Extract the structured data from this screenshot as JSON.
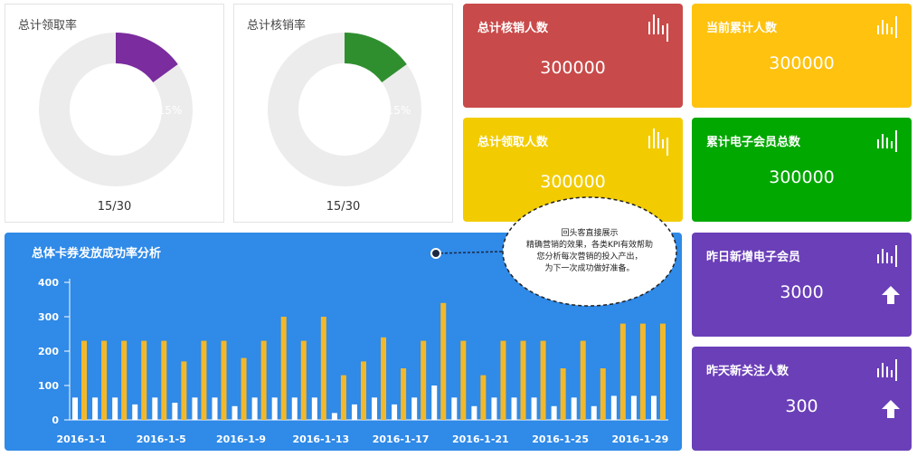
{
  "donuts": [
    {
      "title": "总计领取率",
      "percent_label": "15%",
      "fraction": 0.15,
      "caption": "15/30",
      "color": "#7b2c9e"
    },
    {
      "title": "总计核销率",
      "percent_label": "15%",
      "fraction": 0.15,
      "caption": "15/30",
      "color": "#2f8f2f"
    }
  ],
  "cards": {
    "redeemed": {
      "title": "总计核销人数",
      "value": "300000",
      "color": "#c94a4a"
    },
    "received": {
      "title": "总计领取人数",
      "value": "300000",
      "color": "#f2cc00"
    },
    "cumulative": {
      "title": "当前累计人数",
      "value": "300000",
      "color": "#ffc20e"
    },
    "members": {
      "title": "累计电子会员总数",
      "value": "300000",
      "color": "#00a800"
    },
    "new_members": {
      "title": "昨日新增电子会员",
      "value": "3000",
      "color": "#6a3fb8"
    },
    "new_follow": {
      "title": "昨天新关注人数",
      "value": "300",
      "color": "#6a3fb8"
    }
  },
  "chart": {
    "title": "总体卡券发放成功率分析"
  },
  "bubble": {
    "line1": "回头客直接展示",
    "line2": "精确营销的效果，各类KPI有效帮助",
    "line3": "您分析每次营销的投入产出，",
    "line4": "为下一次成功做好准备。"
  },
  "chart_data": {
    "type": "bar",
    "title": "总体卡券发放成功率分析",
    "ylim": [
      0,
      400
    ],
    "yticks": [
      "0",
      "100",
      "200",
      "300",
      "400"
    ],
    "xtick_labels": [
      "2016-1-1",
      "2016-1-5",
      "2016-1-9",
      "2016-1-13",
      "2016-1-17",
      "2016-1-21",
      "2016-1-25",
      "2016-1-29"
    ],
    "categories": [
      "2016-1-1",
      "2016-1-2",
      "2016-1-3",
      "2016-1-4",
      "2016-1-5",
      "2016-1-6",
      "2016-1-7",
      "2016-1-8",
      "2016-1-9",
      "2016-1-10",
      "2016-1-11",
      "2016-1-12",
      "2016-1-13",
      "2016-1-14",
      "2016-1-15",
      "2016-1-16",
      "2016-1-17",
      "2016-1-18",
      "2016-1-19",
      "2016-1-20",
      "2016-1-21",
      "2016-1-22",
      "2016-1-23",
      "2016-1-24",
      "2016-1-25",
      "2016-1-26",
      "2016-1-27",
      "2016-1-28",
      "2016-1-29",
      "2016-1-30"
    ],
    "series": [
      {
        "values": [
          65,
          65,
          65,
          45,
          65,
          50,
          65,
          65,
          40,
          65,
          65,
          65,
          65,
          20,
          45,
          65,
          45,
          65,
          100,
          65,
          40,
          65,
          65,
          65,
          40,
          65,
          40,
          70,
          70,
          70
        ],
        "color": "#ffffff"
      },
      {
        "values": [
          230,
          230,
          230,
          230,
          230,
          170,
          230,
          230,
          180,
          230,
          300,
          230,
          300,
          130,
          170,
          240,
          150,
          230,
          340,
          230,
          130,
          230,
          230,
          230,
          150,
          230,
          150,
          280,
          280,
          280
        ],
        "color": "#f2b82a"
      }
    ]
  }
}
